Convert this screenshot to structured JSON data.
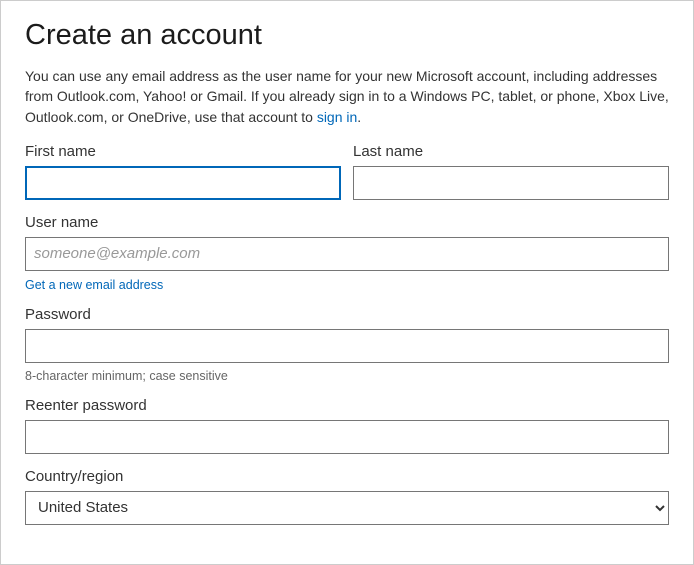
{
  "title": "Create an account",
  "intro_prefix": "You can use any email address as the user name for your new Microsoft account, including addresses from Outlook.com, Yahoo! or Gmail. If you already sign in to a Windows PC, tablet, or phone, Xbox Live, Outlook.com, or OneDrive, use that account to ",
  "intro_link": "sign in",
  "intro_suffix": ".",
  "labels": {
    "first_name": "First name",
    "last_name": "Last name",
    "user_name": "User name",
    "password": "Password",
    "reenter_password": "Reenter password",
    "country_region": "Country/region"
  },
  "values": {
    "first_name": "",
    "last_name": "",
    "user_name": "",
    "password": "",
    "reenter_password": "",
    "country_region": "United States"
  },
  "placeholders": {
    "user_name": "someone@example.com"
  },
  "links": {
    "get_new_email": "Get a new email address"
  },
  "hints": {
    "password": "8-character minimum; case sensitive"
  },
  "country_options": [
    "United States"
  ]
}
